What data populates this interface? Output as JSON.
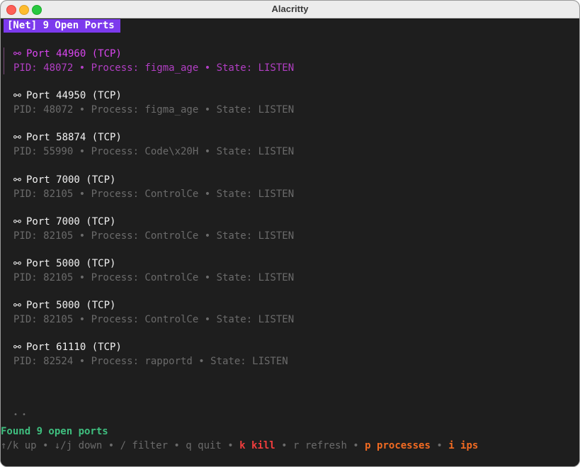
{
  "window": {
    "title": "Alacritty"
  },
  "header": {
    "badge": "[Net] 9 Open Ports"
  },
  "ports": [
    {
      "title": "Port 44960 (TCP)",
      "details": "PID: 48072 • Process: figma_age • State: LISTEN",
      "selected": true
    },
    {
      "title": "Port 44950 (TCP)",
      "details": "PID: 48072 • Process: figma_age • State: LISTEN",
      "selected": false
    },
    {
      "title": "Port 58874 (TCP)",
      "details": "PID: 55990 • Process: Code\\x20H • State: LISTEN",
      "selected": false
    },
    {
      "title": "Port 7000 (TCP)",
      "details": "PID: 82105 • Process: ControlCe • State: LISTEN",
      "selected": false
    },
    {
      "title": "Port 7000 (TCP)",
      "details": "PID: 82105 • Process: ControlCe • State: LISTEN",
      "selected": false
    },
    {
      "title": "Port 5000 (TCP)",
      "details": "PID: 82105 • Process: ControlCe • State: LISTEN",
      "selected": false
    },
    {
      "title": "Port 5000 (TCP)",
      "details": "PID: 82105 • Process: ControlCe • State: LISTEN",
      "selected": false
    },
    {
      "title": "Port 61110 (TCP)",
      "details": "PID: 82524 • Process: rapportd • State: LISTEN",
      "selected": false
    }
  ],
  "pager": {
    "dots": "• •"
  },
  "status": {
    "text": "Found 9 open ports"
  },
  "help": {
    "nav": "↑/k up • ↓/j down • / filter • q quit • ",
    "kill": "k kill",
    "sep1": " • r refresh • ",
    "processes": "p processes",
    "sep2": " • ",
    "ips": "i ips"
  },
  "icons": {
    "port": "link-icon"
  },
  "colors": {
    "badge_bg": "#7c3aed",
    "selected": "#d946ef",
    "status": "#3fbf7f",
    "kill": "#f03d3d",
    "accent_keys": "#f26b22"
  }
}
